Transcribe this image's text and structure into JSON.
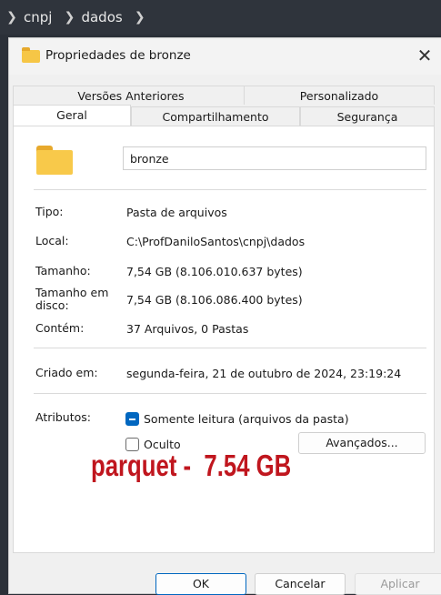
{
  "breadcrumb": {
    "items": [
      "cnpj",
      "dados"
    ]
  },
  "dialog": {
    "title": "Propriedades de bronze",
    "tabs_row_top": [
      "Versões Anteriores",
      "Personalizado"
    ],
    "tabs_row_bottom": [
      "Geral",
      "Compartilhamento",
      "Segurança"
    ],
    "active_tab": "Geral",
    "folder_name": "bronze",
    "props": {
      "tipo_label": "Tipo:",
      "tipo_value": "Pasta de arquivos",
      "local_label": "Local:",
      "local_value": "C:\\ProfDaniloSantos\\cnpj\\dados",
      "tamanho_label": "Tamanho:",
      "tamanho_value": "7,54 GB (8.106.010.637 bytes)",
      "tamanho_disco_label_1": "Tamanho em",
      "tamanho_disco_label_2": "disco:",
      "tamanho_disco_value": "7,54 GB (8.106.086.400 bytes)",
      "contem_label": "Contém:",
      "contem_value": "37 Arquivos, 0 Pastas",
      "criado_label": "Criado em:",
      "criado_value": "segunda-feira, 21 de outubro de 2024, 23:19:24",
      "atributos_label": "Atributos:",
      "somente_leitura_label": "Somente leitura (arquivos da pasta)",
      "oculto_label": "Oculto",
      "avancados_label": "Avançados..."
    },
    "buttons": {
      "ok": "OK",
      "cancel": "Cancelar",
      "apply": "Aplicar"
    }
  },
  "overlay_text": "parquet -  7.54 GB",
  "colors": {
    "accent": "#0067c0",
    "overlay": "#c0161e",
    "folder": "#f8c94a"
  },
  "icons": {
    "chevron": "chevron-right-icon",
    "folder": "folder-icon",
    "close": "close-icon"
  }
}
